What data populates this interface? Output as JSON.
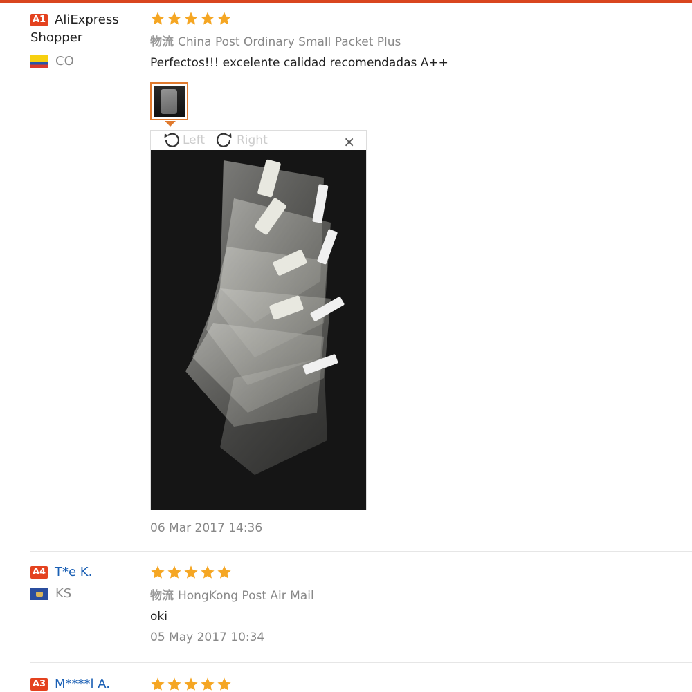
{
  "reviews": [
    {
      "badge": "A1",
      "user": "AliExpress Shopper",
      "country": "CO",
      "rating": 5,
      "shipping_label": "物流",
      "shipping": "China Post Ordinary Small Packet Plus",
      "text": "Perfectos!!! excelente calidad recomendadas A++",
      "date": "06 Mar 2017 14:36"
    },
    {
      "badge": "A4",
      "user": "T*e K.",
      "country": "KS",
      "rating": 5,
      "shipping_label": "物流",
      "shipping": "HongKong Post Air Mail",
      "text": "oki",
      "date": "05 May 2017 10:34"
    },
    {
      "badge": "A3",
      "user": "M****l A.",
      "rating": 5
    }
  ],
  "viewer": {
    "rotate_left": "Left",
    "rotate_right": "Right",
    "close": "×"
  },
  "colors": {
    "accent": "#e4421f",
    "star": "#f5a623",
    "link": "#1a5fb4"
  }
}
